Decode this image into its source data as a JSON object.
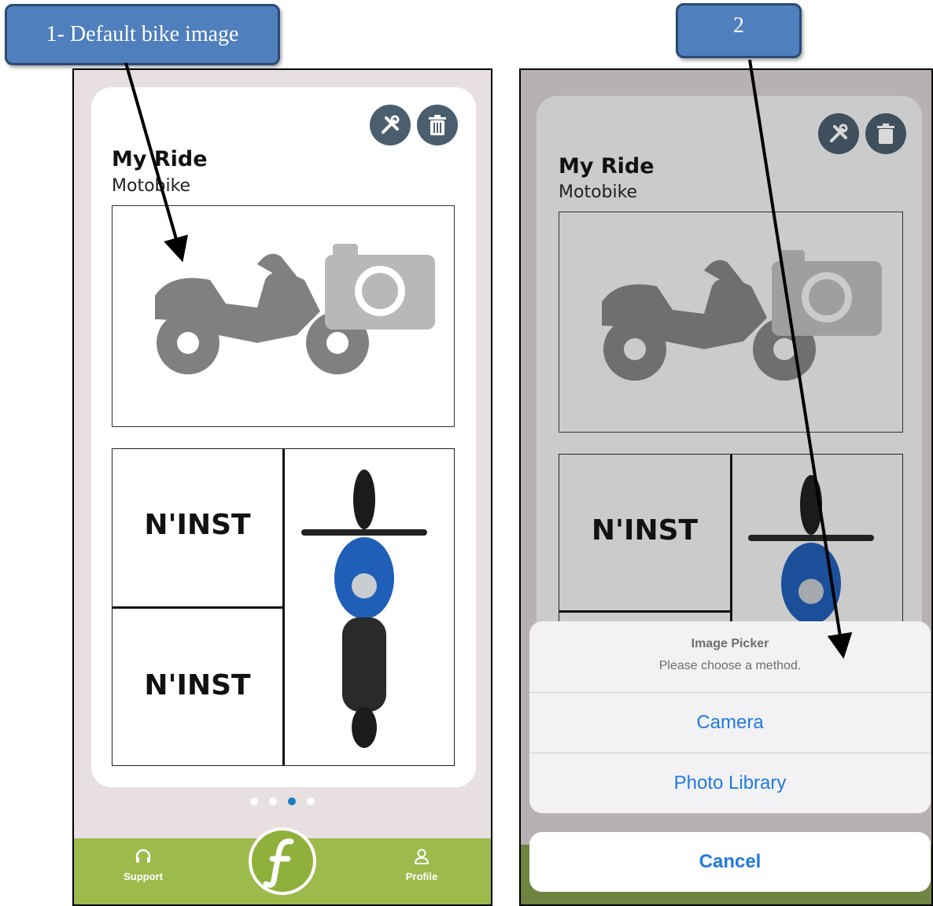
{
  "callouts": {
    "first": "1- Default bike image",
    "second": "2"
  },
  "screen1": {
    "title": "My Ride",
    "subtitle": "Motobike",
    "tiles": [
      "N'INST",
      "N'INST"
    ],
    "nav": {
      "support": "Support",
      "profile": "Profile"
    }
  },
  "screen2": {
    "title": "My Ride",
    "subtitle": "Motobike",
    "tiles": [
      "N'INST"
    ],
    "sheet": {
      "title": "Image Picker",
      "message": "Please choose a method.",
      "options": [
        "Camera",
        "Photo Library"
      ],
      "cancel": "Cancel"
    }
  },
  "icons": [
    "wrench-screwdriver-icon",
    "trash-icon",
    "motorbike-icon",
    "camera-icon",
    "headset-icon",
    "user-icon",
    "brand-f-logo"
  ],
  "colors": {
    "accent": "#9dba4c",
    "primary_blue": "#1f7ae0",
    "callout": "#4f7fbd",
    "icon_button": "#4a5e6e"
  }
}
